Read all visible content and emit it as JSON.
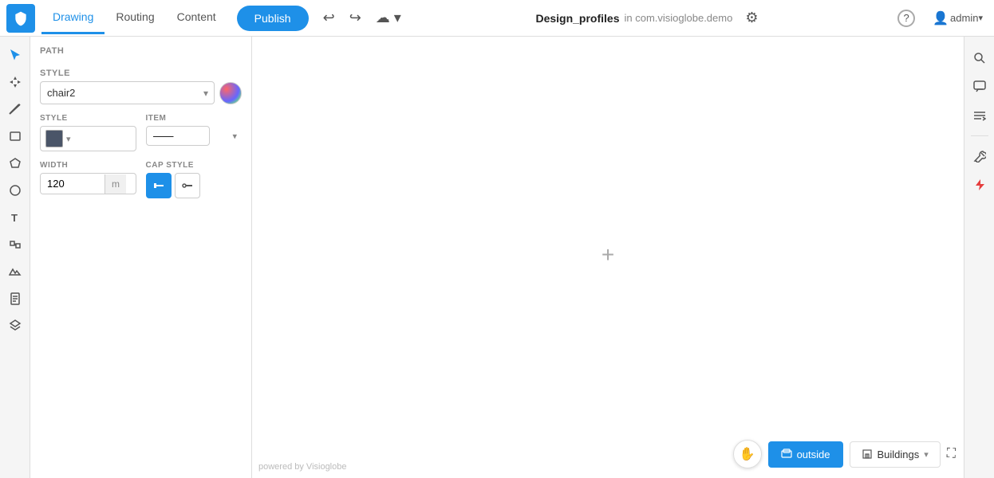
{
  "topbar": {
    "tabs": [
      {
        "id": "drawing",
        "label": "Drawing",
        "active": true
      },
      {
        "id": "routing",
        "label": "Routing",
        "active": false
      },
      {
        "id": "content",
        "label": "Content",
        "active": false
      }
    ],
    "publish_label": "Publish",
    "title_name": "Design_profiles",
    "title_domain": "in com.visioglobe.demo",
    "admin_label": "admin"
  },
  "panel": {
    "section_path": "PATH",
    "section_style": "STYLE",
    "style_value": "chair2",
    "style_label": "STYLE",
    "item_label": "ITEM",
    "width_label": "WIDTH",
    "width_value": "120",
    "width_unit": "m",
    "cap_style_label": "CAP STYLE"
  },
  "canvas": {
    "powered_by": "powered by Visioglobe"
  },
  "bottom_toolbar": {
    "outside_label": "outside",
    "buildings_label": "Buildings"
  },
  "icons": {
    "logo": "V",
    "undo": "↩",
    "redo": "↪",
    "cloud": "☁",
    "search": "🔍",
    "comment": "💬",
    "list": "≡",
    "wrench": "🔧",
    "lightning": "⚡",
    "help": "?",
    "gear": "⚙",
    "hand": "✋",
    "building": "🏢",
    "fullscreen": "⛶"
  }
}
